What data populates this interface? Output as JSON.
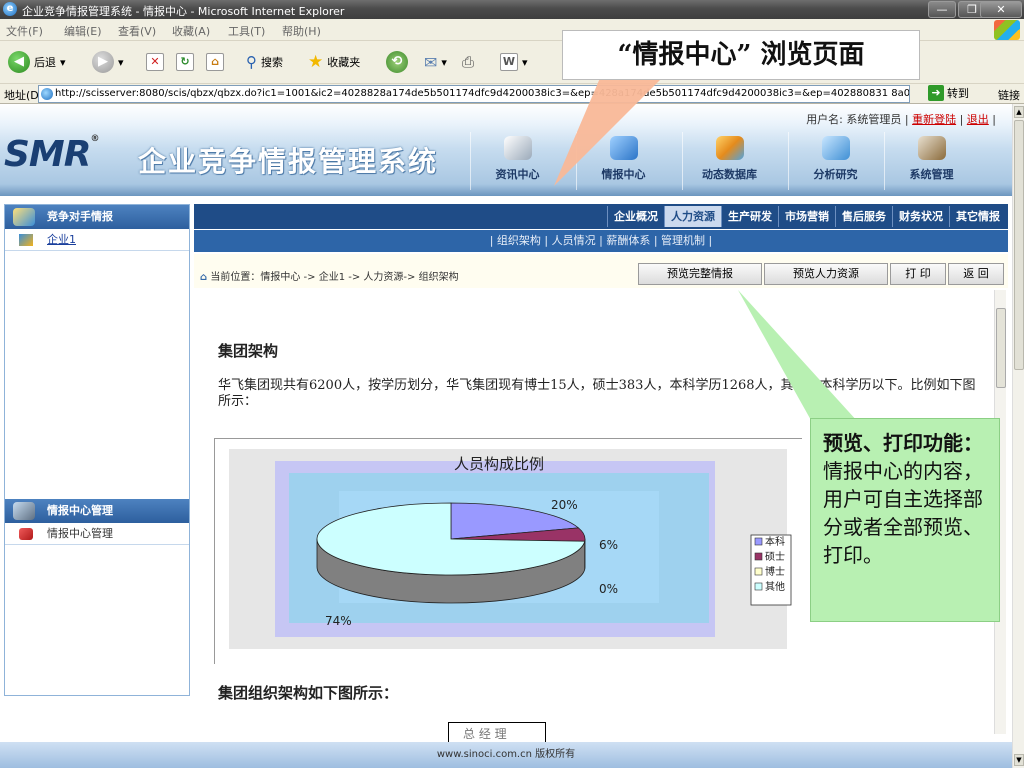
{
  "browser": {
    "window_title": "企业竞争情报管理系统 - 情报中心 - Microsoft Internet Explorer",
    "window_buttons": [
      "—",
      "❐",
      "✕"
    ],
    "menus": [
      "文件(F)",
      "编辑(E)",
      "查看(V)",
      "收藏(A)",
      "工具(T)",
      "帮助(H)"
    ],
    "toolbar": {
      "back": "后退",
      "search": "搜索",
      "favorites": "收藏夹"
    },
    "address_label": "地址(D)",
    "address_url": "http://scisserver:8080/scis/qbzx/qbzx.do?ic1=1001&ic2=4028828a174de5b501174dfc9d4200038ic3=&ep=428a174de5b501174dfc9d4200038ic3=&ep=402880831 8a0df9",
    "go_label": "转到",
    "links_label": "链接"
  },
  "header": {
    "user_label": "用户名: 系统管理员",
    "relogin": "重新登陆",
    "logout": "退出",
    "logo": "SMR",
    "logo_reg": "®",
    "system_name": "企业竞争情报管理系统",
    "nav": [
      {
        "label": "资讯中心",
        "icon": "news-icon",
        "color": "#9aa9b9"
      },
      {
        "label": "情报中心",
        "icon": "intel-icon",
        "color": "#2b74c7"
      },
      {
        "label": "动态数据库",
        "icon": "database-icon",
        "color": "#e58b1c"
      },
      {
        "label": "分析研究",
        "icon": "analysis-icon",
        "color": "#3f8fd4"
      },
      {
        "label": "系统管理",
        "icon": "tools-icon",
        "color": "#8a6a3a"
      }
    ]
  },
  "sidebar": {
    "section1_title": "竞争对手情报",
    "section1_items": [
      "企业1"
    ],
    "section2_title": "情报中心管理",
    "section2_items": [
      "情报中心管理"
    ]
  },
  "categories": [
    "企业概况",
    "人力资源",
    "生产研发",
    "市场营销",
    "售后服务",
    "财务状况",
    "其它情报"
  ],
  "active_category": "人力资源",
  "subnav": "| 组织架构 | 人员情况 | 薪酬体系 | 管理机制 |",
  "location": {
    "prefix": "当前位置：",
    "path": "情报中心 -> 企业1 -> 人力资源-> 组织架构"
  },
  "actions": [
    "预览完整情报",
    "预览人力资源",
    "打 印",
    "返 回"
  ],
  "content": {
    "heading": "集团架构",
    "paragraph": "华飞集团现共有6200人，按学历划分，华飞集团现有博士15人，硕士383人，本科学历1268人，其余为本科学历以下。比例如下图所示：",
    "heading2": "集团组织架构如下图所示：",
    "orgbox": "总 经 理"
  },
  "chart_data": {
    "type": "pie",
    "title": "人员构成比例",
    "categories": [
      "本科",
      "硕士",
      "博士",
      "其他"
    ],
    "values": [
      20,
      6,
      0,
      74
    ],
    "value_labels": [
      "20%",
      "6%",
      "0%",
      "74%"
    ],
    "colors": [
      "#9999ff",
      "#993366",
      "#ffffcc",
      "#ccffff"
    ],
    "legend_position": "right",
    "style": "3d"
  },
  "footer": "www.sinoci.com.cn 版权所有",
  "annotations": {
    "top": "“情报中心” 浏览页面",
    "right_bold": "预览、打印功能：",
    "right_text": "情报中心的内容，用户可自主选择部分或者全部预览、打印。"
  }
}
